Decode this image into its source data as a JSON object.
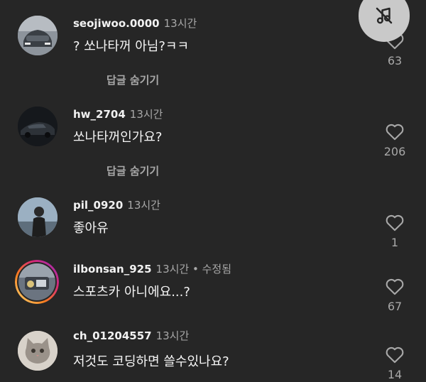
{
  "comments": [
    {
      "username": "seojiwoo.0000",
      "time": "13시간",
      "edited": "",
      "text": "? 쏘나타꺼 아님?ㅋㅋ",
      "likes": "63",
      "hide_replies": "답글 숨기기"
    },
    {
      "username": "hw_2704",
      "time": "13시간",
      "edited": "",
      "text": "쏘나타꺼인가요?",
      "likes": "206",
      "hide_replies": "답글 숨기기"
    },
    {
      "username": "pil_0920",
      "time": "13시간",
      "edited": "",
      "text": "좋아유",
      "likes": "1",
      "hide_replies": ""
    },
    {
      "username": "ilbonsan_925",
      "time": "13시간",
      "edited": " • 수정됨",
      "text": "스포츠카 아니에요...?",
      "likes": "67",
      "hide_replies": ""
    },
    {
      "username": "ch_01204557",
      "time": "13시간",
      "edited": "",
      "text": "저것도 코딩하면 쓸수있나요?",
      "likes": "14",
      "hide_replies": ""
    }
  ],
  "icons": {
    "like": "heart-outline-icon",
    "mute": "music-note-off-icon"
  },
  "colors": {
    "background": "#262626",
    "secondary_text": "#a8a8a8",
    "mute_button": "#c9c9c9",
    "story_ring": [
      "#feda75",
      "#fa7e1e",
      "#d62976",
      "#962fbf"
    ]
  }
}
